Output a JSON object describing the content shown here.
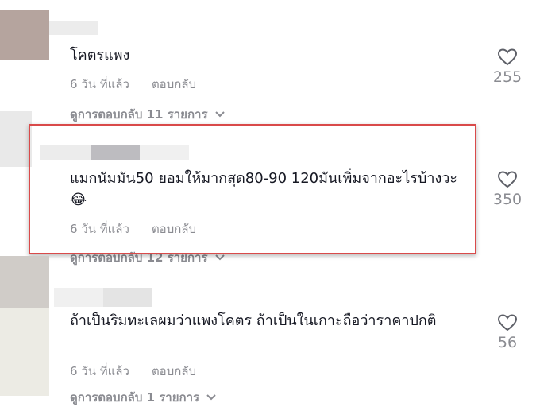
{
  "comments": [
    {
      "text": "โคตรแพง",
      "time": "6 วัน ที่แล้ว",
      "reply_label": "ตอบกลับ",
      "view_replies": "ดูการตอบกลับ 11 รายการ",
      "likes": "255",
      "icons": {
        "like": "heart-icon",
        "expand": "chevron-down-icon"
      }
    },
    {
      "text": "แมกนัมมัน50 ยอมให้มากสุด80-90 120มันเพิ่มจากอะไรบ้างวะ😂",
      "time": "6 วัน ที่แล้ว",
      "reply_label": "ตอบกลับ",
      "view_replies": "ดูการตอบกลับ 12 รายการ",
      "likes": "350",
      "icons": {
        "like": "heart-icon",
        "expand": "chevron-down-icon"
      }
    },
    {
      "text": "ถ้าเป็นริมทะเลผมว่าแพงโคตร ถ้าเป็นในเกาะถือว่าราคาปกติ",
      "time": "6 วัน ที่แล้ว",
      "reply_label": "ตอบกลับ",
      "view_replies": "ดูการตอบกลับ 1 รายการ",
      "likes": "56",
      "icons": {
        "like": "heart-icon",
        "expand": "chevron-down-icon"
      }
    }
  ],
  "colors": {
    "highlight_border": "#d94a4a",
    "secondary_text": "#8a8b91",
    "primary_text": "#161823"
  }
}
